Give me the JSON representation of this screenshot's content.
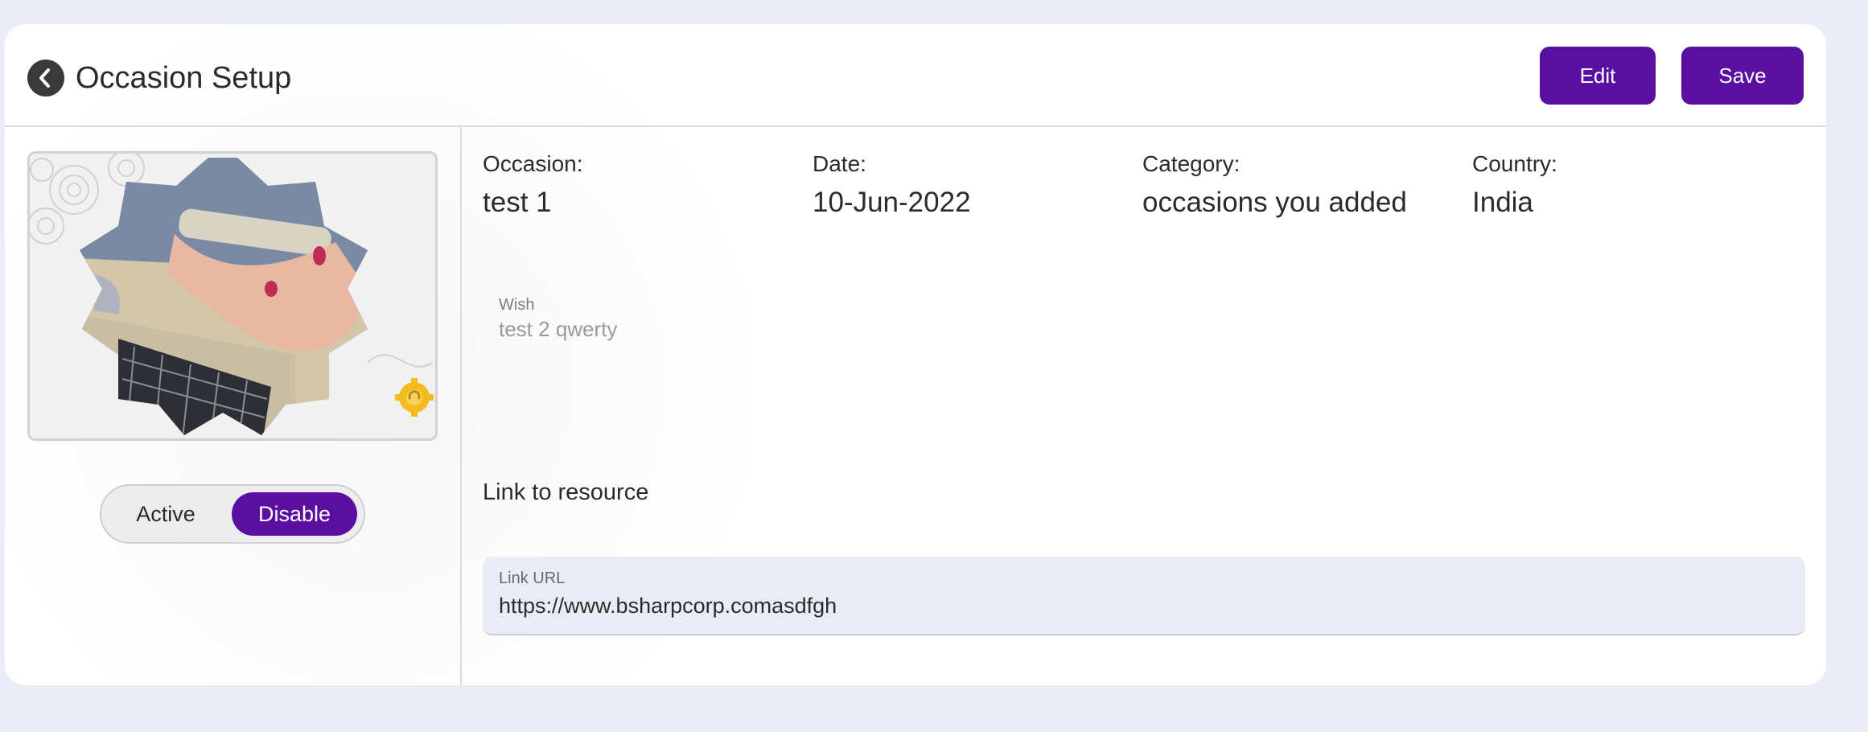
{
  "header": {
    "title": "Occasion Setup",
    "edit_label": "Edit",
    "save_label": "Save"
  },
  "status_toggle": {
    "options": [
      "Active",
      "Disable"
    ],
    "selected": "Disable"
  },
  "details": {
    "occasion": {
      "label": "Occasion:",
      "value": "test 1"
    },
    "date": {
      "label": "Date:",
      "value": "10-Jun-2022"
    },
    "category": {
      "label": "Category:",
      "value": "occasions you added"
    },
    "country": {
      "label": "Country:",
      "value": "India"
    }
  },
  "wish": {
    "label": "Wish",
    "value": "test 2 qwerty"
  },
  "link": {
    "heading": "Link to resource",
    "url_label": "Link URL",
    "url_value": "https://www.bsharpcorp.comasdfgh"
  },
  "colors": {
    "accent": "#5a0fa0",
    "page_background": "#eaedf5",
    "card_background": "#ffffff",
    "input_background": "#e9ecf4"
  },
  "icons": {
    "back": "chevron-left-circle-icon",
    "badge": "gold-gear-badge-icon"
  }
}
